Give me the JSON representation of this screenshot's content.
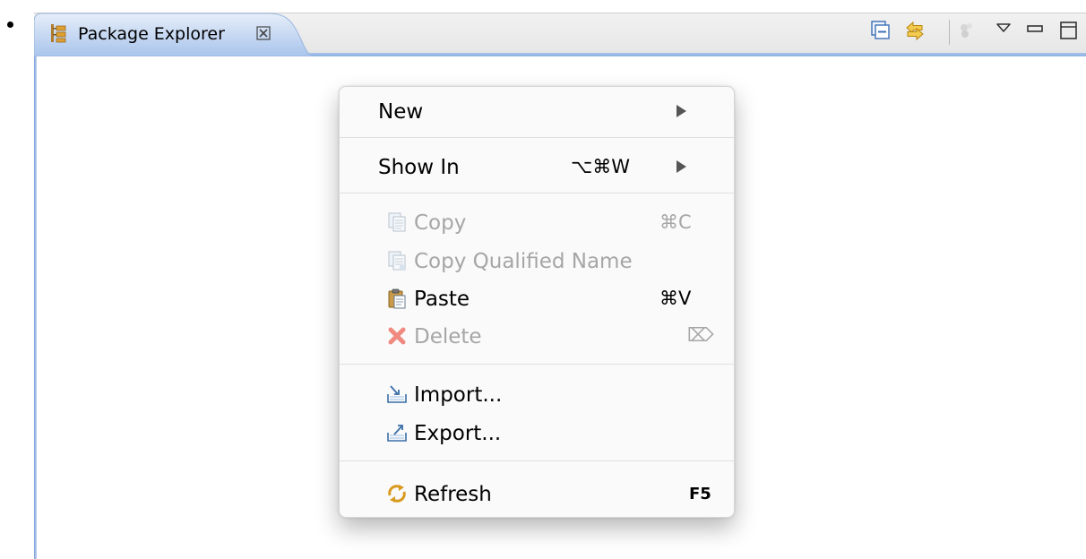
{
  "view": {
    "tab_title": "Package Explorer",
    "tab_icon": "package-explorer-icon",
    "toolbar": [
      {
        "name": "collapse-all-icon"
      },
      {
        "name": "link-with-editor-icon"
      },
      {
        "name": "filter-icon"
      },
      {
        "name": "view-menu-icon"
      },
      {
        "name": "minimize-icon"
      },
      {
        "name": "maximize-icon"
      }
    ]
  },
  "colors": {
    "tab_accent": "#8eb0e2",
    "disabled_text": "#a6a6a6"
  },
  "menu": {
    "new": {
      "label": "New",
      "submenu": true
    },
    "show_in": {
      "label": "Show In",
      "shortcut": "⌥⌘W",
      "submenu": true
    },
    "copy": {
      "label": "Copy",
      "shortcut": "⌘C",
      "enabled": false,
      "icon": "copy-icon"
    },
    "copy_qualified": {
      "label": "Copy Qualified Name",
      "enabled": false,
      "icon": "copy-qualified-name-icon"
    },
    "paste": {
      "label": "Paste",
      "shortcut": "⌘V",
      "enabled": true,
      "icon": "paste-icon"
    },
    "delete": {
      "label": "Delete",
      "shortcut": "⌦",
      "enabled": false,
      "icon": "delete-icon"
    },
    "import": {
      "label": "Import...",
      "icon": "import-icon"
    },
    "export": {
      "label": "Export...",
      "icon": "export-icon"
    },
    "refresh": {
      "label": "Refresh",
      "shortcut": "F5",
      "icon": "refresh-icon"
    }
  }
}
